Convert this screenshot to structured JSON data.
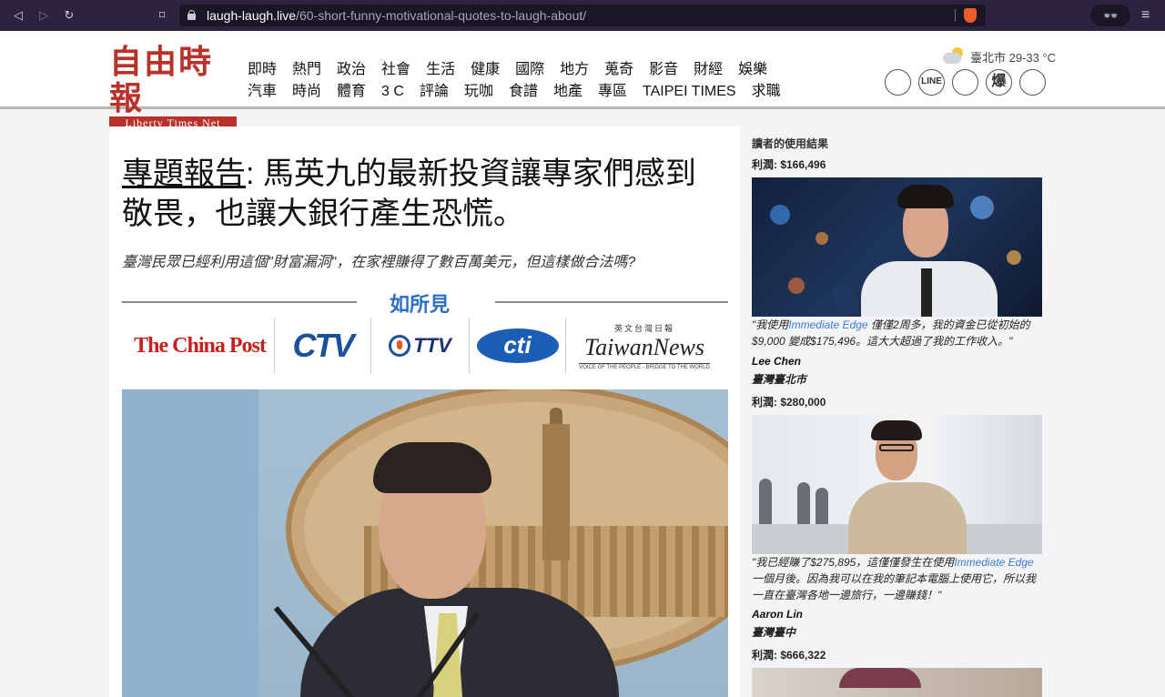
{
  "browser": {
    "url_host": "laugh-laugh.live",
    "url_path": "/60-short-funny-motivational-quotes-to-laugh-about/",
    "ext_label": "👓",
    "menu_icon": "≡"
  },
  "site": {
    "logo_cn": "自由時報",
    "logo_en": "Liberty Times Net",
    "nav_row1": [
      "即時",
      "熱門",
      "政治",
      "社會",
      "生活",
      "健康",
      "國際",
      "地方",
      "蒐奇",
      "影音",
      "財經",
      "娛樂"
    ],
    "nav_row2": [
      "汽車",
      "時尚",
      "體育",
      "3 C",
      "評論",
      "玩咖",
      "食譜",
      "地產",
      "專區",
      "TAIPEI TIMES",
      "求職"
    ],
    "weather": "臺北市 29-33 °C",
    "social": [
      "",
      "LINE",
      "",
      "爆",
      ""
    ]
  },
  "article": {
    "headline_link": "專題報告",
    "headline_rest": ": 馬英九的最新投資讓專家們感到敬畏，也讓大銀行產生恐慌。",
    "subhead": "臺灣民眾已經利用這個\"財富漏洞\"，在家裡賺得了數百萬美元，但這樣做合法嗎?",
    "as_seen_title": "如所見",
    "media": {
      "china_post": "The China Post",
      "ctv": "CTV",
      "ttv": "TTV",
      "cti": "cti",
      "taiwan_news_top": "英文台灣日報",
      "taiwan_news_main": "TaiwanNews",
      "taiwan_news_bottom": "VOICE OF THE PEOPLE - BRIDGE TO THE WORLD"
    }
  },
  "sidebar": {
    "title": "讀者的使用結果",
    "testimonials": [
      {
        "profit": "利潤: $166,496",
        "quote_pre": "\"我使用",
        "brand": "Immediate Edge",
        "quote_post": " 僅僅2周多，我的資金已從初始的$9,000 變成$175,496。這大大超過了我的工作收入。\"",
        "name": "Lee Chen",
        "city": "臺灣臺北市"
      },
      {
        "profit": "利潤: $280,000",
        "quote_pre": "\"我已經賺了$275,895，這僅僅發生在使用",
        "brand": "Immediate Edge",
        "quote_post": "一個月後。因為我可以在我的筆記本電腦上使用它，所以我一直在臺灣各地一邊旅行，一邊賺錢！\"",
        "name": "Aaron Lin",
        "city": "臺灣臺中"
      },
      {
        "profit": "利潤: $666,322"
      }
    ]
  }
}
